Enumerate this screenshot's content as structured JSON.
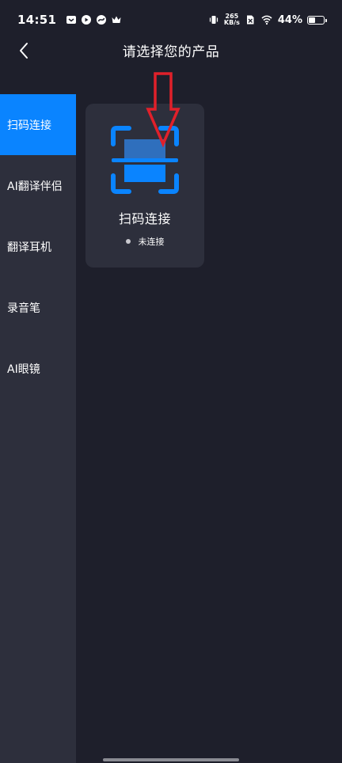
{
  "status_bar": {
    "time": "14:51",
    "net_speed_value": "265",
    "net_speed_unit": "KB/s",
    "battery_percent": "44%",
    "battery_level": 0.44
  },
  "header": {
    "title": "请选择您的产品"
  },
  "sidebar": {
    "items": [
      {
        "label": "扫码连接",
        "active": true
      },
      {
        "label": "AI翻译伴侣",
        "active": false
      },
      {
        "label": "翻译耳机",
        "active": false
      },
      {
        "label": "录音笔",
        "active": false
      },
      {
        "label": "AI眼镜",
        "active": false
      }
    ]
  },
  "product_card": {
    "title": "扫码连接",
    "status": "未连接",
    "icon": "scan-qr-icon"
  },
  "colors": {
    "background": "#1e1f2b",
    "panel": "#2d2f3c",
    "accent": "#0a84ff",
    "annotation_arrow": "#e0202a"
  }
}
